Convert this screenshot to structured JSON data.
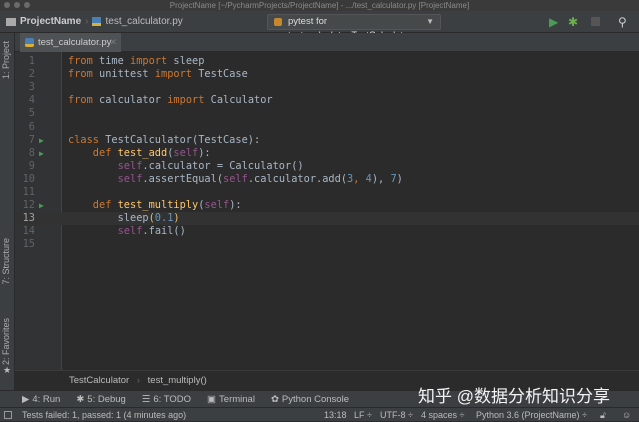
{
  "window": {
    "title": "ProjectName [~/PycharmProjects/ProjectName] - .../test_calculator.py [ProjectName]"
  },
  "nav": {
    "project": "ProjectName",
    "file": "test_calculator.py",
    "run_config": "pytest for test_calculator.TestCalculator"
  },
  "left_panels": {
    "project": "1: Project",
    "structure": "7: Structure",
    "favorites": "2: Favorites"
  },
  "tab": {
    "label": "test_calculator.py"
  },
  "code": [
    {
      "n": "1",
      "t": [
        [
          "from",
          "kw"
        ],
        [
          " time ",
          "plain"
        ],
        [
          "import",
          "kw"
        ],
        [
          " sleep",
          "plain"
        ]
      ]
    },
    {
      "n": "2",
      "t": [
        [
          "from",
          "kw"
        ],
        [
          " unittest ",
          "plain"
        ],
        [
          "import",
          "kw"
        ],
        [
          " TestCase",
          "plain"
        ]
      ]
    },
    {
      "n": "3",
      "t": []
    },
    {
      "n": "4",
      "t": [
        [
          "from",
          "kw"
        ],
        [
          " calculator ",
          "plain"
        ],
        [
          "import",
          "kw"
        ],
        [
          " Calculator",
          "plain"
        ]
      ]
    },
    {
      "n": "5",
      "t": []
    },
    {
      "n": "6",
      "t": []
    },
    {
      "n": "7",
      "run": true,
      "t": [
        [
          "class",
          "kw"
        ],
        [
          " TestCalculator(TestCase):",
          "plain"
        ]
      ]
    },
    {
      "n": "8",
      "run": true,
      "t": [
        [
          "    def ",
          "kw"
        ],
        [
          "test_add",
          "fn"
        ],
        [
          "(",
          "plain"
        ],
        [
          "self",
          "self"
        ],
        [
          "):",
          "plain"
        ]
      ]
    },
    {
      "n": "9",
      "t": [
        [
          "        ",
          "plain"
        ],
        [
          "self",
          "self"
        ],
        [
          ".calculator = Calculator()",
          "plain"
        ]
      ]
    },
    {
      "n": "10",
      "t": [
        [
          "        ",
          "plain"
        ],
        [
          "self",
          "self"
        ],
        [
          ".assertEqual(",
          "plain"
        ],
        [
          "self",
          "self"
        ],
        [
          ".calculator.add(",
          "plain"
        ],
        [
          "3",
          "num"
        ],
        [
          ", ",
          "kw"
        ],
        [
          "4",
          "num"
        ],
        [
          "), ",
          "plain"
        ],
        [
          "7",
          "num"
        ],
        [
          ")",
          "plain"
        ]
      ]
    },
    {
      "n": "11",
      "t": []
    },
    {
      "n": "12",
      "run": true,
      "t": [
        [
          "    def ",
          "kw"
        ],
        [
          "test_multiply",
          "fn"
        ],
        [
          "(",
          "plain"
        ],
        [
          "self",
          "self"
        ],
        [
          "):",
          "plain"
        ]
      ]
    },
    {
      "n": "13",
      "cur": true,
      "t": [
        [
          "        sleep",
          "plain"
        ],
        [
          "(",
          "paren"
        ],
        [
          "0.1",
          "num"
        ],
        [
          ")",
          "paren"
        ]
      ]
    },
    {
      "n": "14",
      "t": [
        [
          "        ",
          "plain"
        ],
        [
          "self",
          "self"
        ],
        [
          ".fail()",
          "plain"
        ]
      ]
    },
    {
      "n": "15",
      "t": []
    }
  ],
  "breadcrumb": {
    "class": "TestCalculator",
    "method": "test_multiply()"
  },
  "tool_windows": [
    "4: Run",
    "5: Debug",
    "6: TODO",
    "Terminal",
    "Python Console"
  ],
  "status": {
    "message": "Tests failed: 1, passed: 1 (4 minutes ago)",
    "position": "13:18",
    "line_sep": "LF ÷",
    "encoding": "UTF-8 ÷",
    "indent": "4 spaces ÷",
    "interpreter": "Python 3.6 (ProjectName) ÷"
  },
  "watermark": "知乎 @数据分析知识分享"
}
